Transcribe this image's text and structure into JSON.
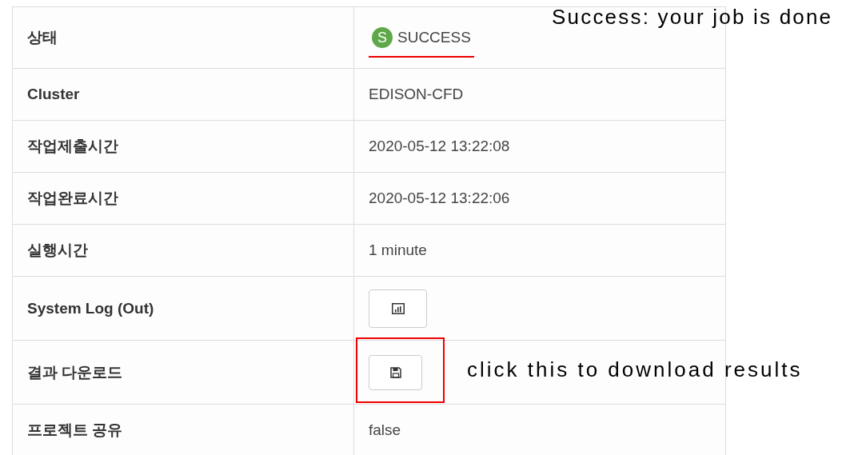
{
  "job_details": {
    "rows": [
      {
        "label": "상태",
        "kind": "status",
        "badge": "S",
        "value": "SUCCESS",
        "highlighted": true
      },
      {
        "label": "Cluster",
        "kind": "text",
        "value": "EDISON-CFD"
      },
      {
        "label": "작업제출시간",
        "kind": "text",
        "value": "2020-05-12 13:22:08"
      },
      {
        "label": "작업완료시간",
        "kind": "text",
        "value": "2020-05-12 13:22:06"
      },
      {
        "label": "실행시간",
        "kind": "text",
        "value": "1 minute"
      },
      {
        "label": "System Log (Out)",
        "kind": "log_button",
        "highlighted": false
      },
      {
        "label": "결과 다운로드",
        "kind": "download_button",
        "highlighted": true
      },
      {
        "label": "프로젝트 공유",
        "kind": "text",
        "value": "false"
      }
    ]
  },
  "annotations": [
    {
      "text": "Success: your job is done"
    },
    {
      "text": "click this to download results"
    }
  ]
}
